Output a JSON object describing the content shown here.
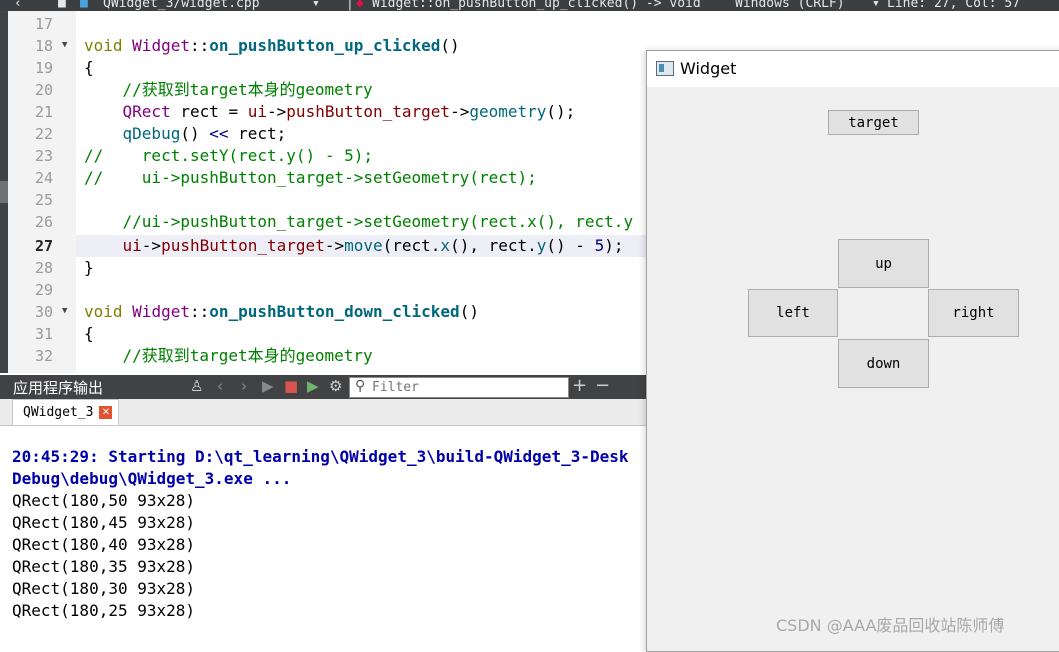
{
  "top_bar": {
    "file_name": "QWidget_3/widget.cpp",
    "function": "Widget::on_pushButton_up_clicked() -> void",
    "line_ending": "Windows (CRLF)",
    "position": "Line: 27, Col: 57"
  },
  "editor": {
    "line_numbers": [
      "17",
      "18",
      "19",
      "20",
      "21",
      "22",
      "23",
      "24",
      "25",
      "26",
      "27",
      "28",
      "29",
      "30",
      "31",
      "32"
    ],
    "current_line": "27"
  },
  "output": {
    "title": "应用程序输出",
    "filter_placeholder": "Filter",
    "tab_label": "QWidget_3",
    "lines": [
      "20:45:29: Starting D:\\qt_learning\\QWidget_3\\build-QWidget_3-Desk",
      "Debug\\debug\\QWidget_3.exe ...",
      "QRect(180,50 93x28)",
      "QRect(180,45 93x28)",
      "QRect(180,40 93x28)",
      "QRect(180,35 93x28)",
      "QRect(180,30 93x28)",
      "QRect(180,25 93x28)"
    ]
  },
  "widget_window": {
    "title": "Widget",
    "buttons": {
      "target": "target",
      "up": "up",
      "left": "left",
      "right": "right",
      "down": "down"
    }
  },
  "watermark": "CSDN @AAA废品回收站陈师傅"
}
